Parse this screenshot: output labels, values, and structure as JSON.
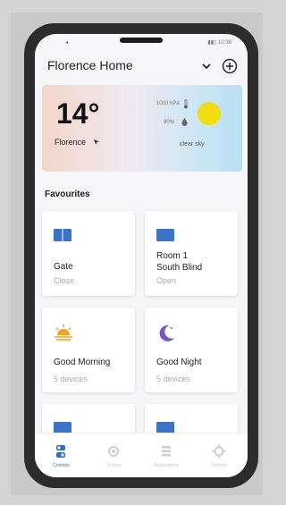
{
  "status": {
    "left": "◂",
    "right": "▮▮▯ 10:38"
  },
  "header": {
    "title": "Florence Home"
  },
  "weather": {
    "temperature": "14°",
    "city": "Florence",
    "pressure": "1010 hPa",
    "humidity": "80%",
    "condition": "clear sky"
  },
  "favourites": {
    "title": "Favourites",
    "tiles": [
      {
        "name": "Gate",
        "status": "Close",
        "icon": "blind-icon"
      },
      {
        "name_line1": "Room 1",
        "name_line2": "South Blind",
        "status": "Open",
        "icon": "blind-icon"
      },
      {
        "name": "Good Morning",
        "status": "5 devices",
        "icon": "sunrise-icon"
      },
      {
        "name": "Good Night",
        "status": "5 devices",
        "icon": "moon-icon"
      },
      {
        "icon": "blind-icon"
      },
      {
        "icon": "blind-icon"
      }
    ]
  },
  "nav": [
    {
      "label": "Controls",
      "icon": "controls-icon",
      "active": true
    },
    {
      "label": "Scenes",
      "icon": "scenes-icon"
    },
    {
      "label": "Automations",
      "icon": "list-icon"
    },
    {
      "label": "Settings",
      "icon": "gear-icon"
    }
  ],
  "colors": {
    "accent": "#2c6fc8",
    "blind": "#3a74c9",
    "sun": "#f2dc12",
    "sunrise": "#f2a31f",
    "moon": "#7b55c7"
  }
}
